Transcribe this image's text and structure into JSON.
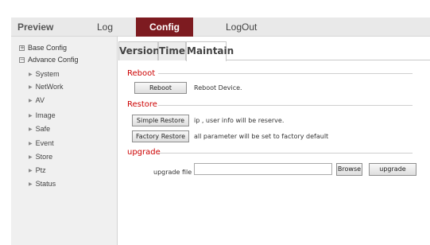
{
  "nav": {
    "preview": "Preview",
    "log": "Log",
    "config": "Config",
    "logout": "LogOut",
    "active": "Config",
    "active_color": "#7d1b20"
  },
  "sidebar": {
    "base_config": {
      "label": "Base Config",
      "toggle": "⊞"
    },
    "advance_config": {
      "label": "Advance Config",
      "toggle": "⊟"
    },
    "items": [
      "System",
      "NetWork",
      "AV",
      "Image",
      "Safe",
      "Event",
      "Store",
      "Ptz",
      "Status"
    ]
  },
  "tabs": {
    "version": "Version",
    "time": "Time",
    "maintain": "Maintain",
    "active": "Maintain"
  },
  "reboot": {
    "title": "Reboot",
    "button": "Reboot",
    "desc": "Reboot Device."
  },
  "restore": {
    "title": "Restore",
    "simple_button": "Simple Restore",
    "simple_desc": "ip , user info will be reserve.",
    "factory_button": "Factory Restore",
    "factory_desc": "all parameter will be set to factory default"
  },
  "upgrade": {
    "title": "upgrade",
    "file_label": "upgrade file",
    "file_value": "",
    "browse_button": "Browse",
    "upgrade_button": "upgrade"
  },
  "colors": {
    "accent": "#7d1b20",
    "section_title": "#cc0000"
  }
}
